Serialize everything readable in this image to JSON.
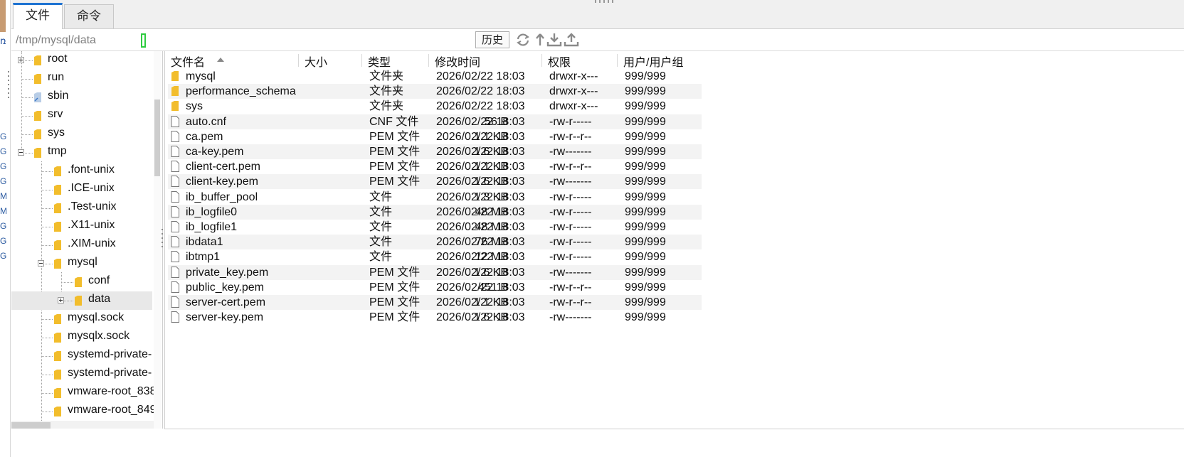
{
  "tabs": [
    {
      "label": "文件",
      "active": true
    },
    {
      "label": "命令",
      "active": false
    }
  ],
  "left_strip": {
    "partial_text": "ռ",
    "row_fragments": [
      "G",
      "G",
      "G",
      "G",
      "M",
      "M",
      "G",
      "G",
      "G"
    ]
  },
  "pathbar": {
    "path": "/tmp/mysql/data",
    "history_button": "历史",
    "icons": [
      "refresh-icon",
      "up-folder-icon",
      "download-icon",
      "upload-icon"
    ]
  },
  "tree": {
    "items": [
      {
        "label": "root",
        "depth": 0,
        "expander": "plus"
      },
      {
        "label": "run",
        "depth": 0,
        "expander": null
      },
      {
        "label": "sbin",
        "depth": 0,
        "expander": null,
        "icon": "link"
      },
      {
        "label": "srv",
        "depth": 0,
        "expander": null
      },
      {
        "label": "sys",
        "depth": 0,
        "expander": null
      },
      {
        "label": "tmp",
        "depth": 0,
        "expander": "minus"
      },
      {
        "label": ".font-unix",
        "depth": 1,
        "expander": null
      },
      {
        "label": ".ICE-unix",
        "depth": 1,
        "expander": null
      },
      {
        "label": ".Test-unix",
        "depth": 1,
        "expander": null
      },
      {
        "label": ".X11-unix",
        "depth": 1,
        "expander": null
      },
      {
        "label": ".XIM-unix",
        "depth": 1,
        "expander": null
      },
      {
        "label": "mysql",
        "depth": 1,
        "expander": "minus"
      },
      {
        "label": "conf",
        "depth": 2,
        "expander": null
      },
      {
        "label": "data",
        "depth": 2,
        "expander": "plus",
        "selected": true
      },
      {
        "label": "mysql.sock",
        "depth": 1,
        "expander": null
      },
      {
        "label": "mysqlx.sock",
        "depth": 1,
        "expander": null
      },
      {
        "label": "systemd-private-",
        "depth": 1,
        "expander": null
      },
      {
        "label": "systemd-private-",
        "depth": 1,
        "expander": null
      },
      {
        "label": "vmware-root_838",
        "depth": 1,
        "expander": null
      },
      {
        "label": "vmware-root_849",
        "depth": 1,
        "expander": null
      }
    ]
  },
  "file_list": {
    "columns": [
      "文件名",
      "大小",
      "类型",
      "修改时间",
      "权限",
      "用户/用户组"
    ],
    "rows": [
      {
        "name": "mysql",
        "size": "",
        "type": "文件夹",
        "modified": "2026/02/22 18:03",
        "perm": "drwxr-x---",
        "owner": "999/999",
        "kind": "folder"
      },
      {
        "name": "performance_schema",
        "size": "",
        "type": "文件夹",
        "modified": "2026/02/22 18:03",
        "perm": "drwxr-x---",
        "owner": "999/999",
        "kind": "folder"
      },
      {
        "name": "sys",
        "size": "",
        "type": "文件夹",
        "modified": "2026/02/22 18:03",
        "perm": "drwxr-x---",
        "owner": "999/999",
        "kind": "folder"
      },
      {
        "name": "auto.cnf",
        "size": "56 B",
        "type": "CNF 文件",
        "modified": "2026/02/22 18:03",
        "perm": "-rw-r-----",
        "owner": "999/999",
        "kind": "file"
      },
      {
        "name": "ca.pem",
        "size": "1.1 KB",
        "type": "PEM 文件",
        "modified": "2026/02/22 18:03",
        "perm": "-rw-r--r--",
        "owner": "999/999",
        "kind": "file"
      },
      {
        "name": "ca-key.pem",
        "size": "1.6 KB",
        "type": "PEM 文件",
        "modified": "2026/02/22 18:03",
        "perm": "-rw-------",
        "owner": "999/999",
        "kind": "file"
      },
      {
        "name": "client-cert.pem",
        "size": "1.1 KB",
        "type": "PEM 文件",
        "modified": "2026/02/22 18:03",
        "perm": "-rw-r--r--",
        "owner": "999/999",
        "kind": "file"
      },
      {
        "name": "client-key.pem",
        "size": "1.6 KB",
        "type": "PEM 文件",
        "modified": "2026/02/22 18:03",
        "perm": "-rw-------",
        "owner": "999/999",
        "kind": "file"
      },
      {
        "name": "ib_buffer_pool",
        "size": "1.3 KB",
        "type": "文件",
        "modified": "2026/02/22 18:03",
        "perm": "-rw-r-----",
        "owner": "999/999",
        "kind": "file"
      },
      {
        "name": "ib_logfile0",
        "size": "48 MB",
        "type": "文件",
        "modified": "2026/02/22 18:03",
        "perm": "-rw-r-----",
        "owner": "999/999",
        "kind": "file"
      },
      {
        "name": "ib_logfile1",
        "size": "48 MB",
        "type": "文件",
        "modified": "2026/02/22 18:03",
        "perm": "-rw-r-----",
        "owner": "999/999",
        "kind": "file"
      },
      {
        "name": "ibdata1",
        "size": "76 MB",
        "type": "文件",
        "modified": "2026/02/22 18:03",
        "perm": "-rw-r-----",
        "owner": "999/999",
        "kind": "file"
      },
      {
        "name": "ibtmp1",
        "size": "12 MB",
        "type": "文件",
        "modified": "2026/02/22 18:03",
        "perm": "-rw-r-----",
        "owner": "999/999",
        "kind": "file"
      },
      {
        "name": "private_key.pem",
        "size": "1.6 KB",
        "type": "PEM 文件",
        "modified": "2026/02/22 18:03",
        "perm": "-rw-------",
        "owner": "999/999",
        "kind": "file"
      },
      {
        "name": "public_key.pem",
        "size": "451 B",
        "type": "PEM 文件",
        "modified": "2026/02/22 18:03",
        "perm": "-rw-r--r--",
        "owner": "999/999",
        "kind": "file"
      },
      {
        "name": "server-cert.pem",
        "size": "1.1 KB",
        "type": "PEM 文件",
        "modified": "2026/02/22 18:03",
        "perm": "-rw-r--r--",
        "owner": "999/999",
        "kind": "file"
      },
      {
        "name": "server-key.pem",
        "size": "1.6 KB",
        "type": "PEM 文件",
        "modified": "2026/02/22 18:03",
        "perm": "-rw-------",
        "owner": "999/999",
        "kind": "file"
      }
    ]
  },
  "colors": {
    "accent": "#1e73d2",
    "folder": "#f2bd2c",
    "selection": "#e8e8e8",
    "row_alt": "#f3f3f3"
  }
}
